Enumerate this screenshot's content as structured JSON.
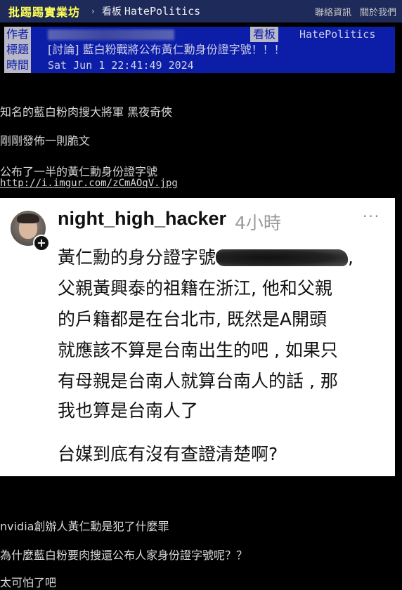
{
  "nav": {
    "brand": "批踢踢實業坊",
    "separator": "›",
    "board_label": "看板",
    "board_name": "HatePolitics",
    "contact": "聯絡資訊",
    "about": "關於我們"
  },
  "meta": {
    "author_key": "作者",
    "author_value": "",
    "board_key": "看板",
    "board_value": "HatePolitics",
    "title_key": "標題",
    "title_value": "[討論] 藍白粉戰將公布黃仁勳身份證字號！！！",
    "time_key": "時間",
    "time_value": "Sat Jun  1 22:41:49 2024"
  },
  "body": {
    "line1": "知名的藍白粉肉搜大將軍 黑夜奇俠",
    "line2": "剛剛發佈一則脆文",
    "line3": "公布了一半的黃仁勳身份證字號",
    "link": "http://i.imgur.com/zCmAOqV.jpg",
    "line4": "nvidia創辦人黃仁勳是犯了什麼罪",
    "line5": "為什麼藍白粉要肉搜還公布人家身份證字號呢？？",
    "line6": "太可怕了吧"
  },
  "embed": {
    "username": "night_high_hacker",
    "time_ago": "4小時",
    "more_icon": "more-icon",
    "plus_icon": "+",
    "line1_prefix": "黃仁勳的身分證字號",
    "line1_suffix": ",",
    "line2": "父親黃興泰的祖籍在浙江, 他和父親",
    "line3": "的戶籍都是在台北市, 既然是A開頭",
    "line4": "就應該不算是台南出生的吧 , 如果只",
    "line5": "有母親是台南人就算台南人的話 , 那",
    "line6": "我也算是台南人了",
    "line7": "台媒到底有沒有查證清楚啊?"
  },
  "colors": {
    "nav_bg": "#1e2a5a",
    "brand": "#ffff55",
    "meta_bg": "#0c1ea8",
    "meta_key_bg": "#b8b8c8",
    "page_bg": "#000000",
    "text": "#d8d8d8"
  }
}
